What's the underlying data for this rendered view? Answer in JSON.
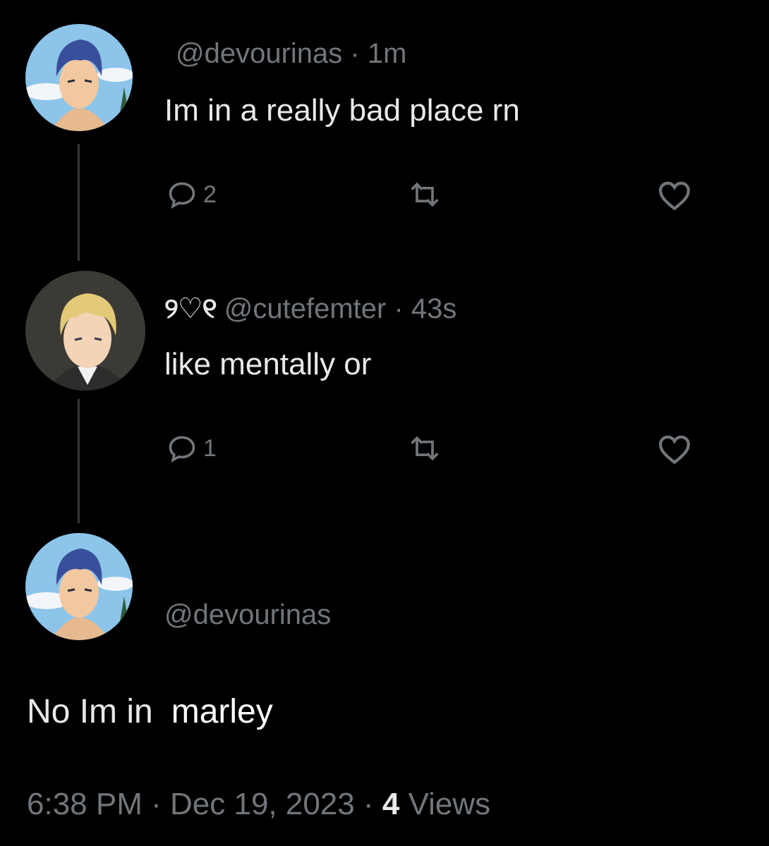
{
  "colors": {
    "background": "#000000",
    "primary_text": "#e7e9ea",
    "secondary_text": "#71767b",
    "thread_line": "#333639"
  },
  "reply_1": {
    "handle": "@devourinas",
    "separator": "·",
    "time": "1m",
    "text": "Im in a really bad place rn",
    "reply_count": "2",
    "icons": [
      "reply-icon",
      "retweet-icon",
      "like-icon"
    ]
  },
  "reply_2": {
    "display_name": "୨♡୧",
    "handle": "@cutefemter",
    "separator": "·",
    "time": "43s",
    "text": "like mentally or",
    "reply_count": "1",
    "icons": [
      "reply-icon",
      "retweet-icon",
      "like-icon"
    ]
  },
  "main_tweet": {
    "handle": "@devourinas",
    "text_part1": "No Im in",
    "text_part2": "marley",
    "time": "6:38 PM",
    "separator": "·",
    "date": "Dec 19, 2023",
    "views_count": "4",
    "views_label": "Views"
  }
}
